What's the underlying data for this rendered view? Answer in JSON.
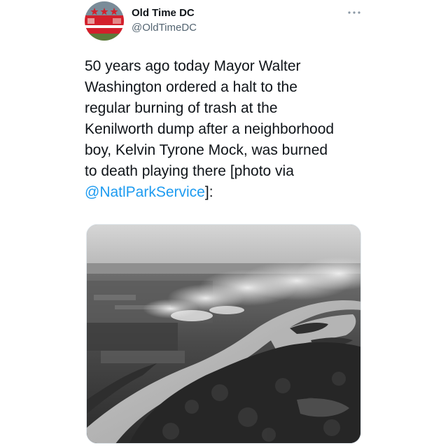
{
  "tweet": {
    "author": {
      "display_name": "Old Time DC",
      "handle": "@OldTimeDC",
      "avatar_icon": "dc-flag-avatar-icon"
    },
    "more_icon": "more-dots-icon",
    "text_before_mention": "50 years ago today Mayor Walter\nWashington ordered a halt to the\nregular burning of trash at the\nKenilworth dump after a neighborhood\nboy, Kelvin Tyrone Mock, was burned\nto death playing there [photo via\n",
    "mention": "@NatlParkService",
    "text_after_mention": "]:",
    "media": {
      "kind": "black-and-white aerial photograph",
      "subject": "smoke rising from a burning dump beside a winding river"
    }
  },
  "colors": {
    "text": "#0f1419",
    "secondary_text": "#536471",
    "link": "#1d9bf0",
    "dc_flag_red": "#d31f2b"
  }
}
